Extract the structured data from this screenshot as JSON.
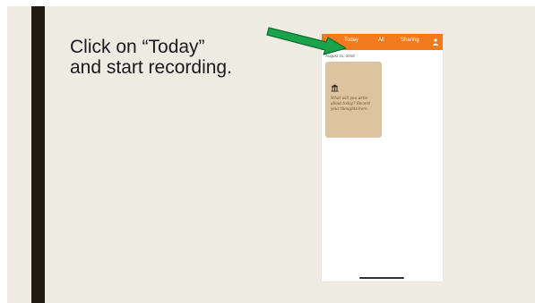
{
  "instruction": {
    "line1": "Click on “Today”",
    "line2": "and start recording."
  },
  "phone": {
    "tabs": {
      "today": "Today",
      "all": "All",
      "sharing": "Sharing"
    },
    "profile_icon": "person-icon",
    "date": "August 31, 2018",
    "card": {
      "icon": "building-icon",
      "prompt": "What will you write about today? Record your thoughts here."
    }
  },
  "colors": {
    "slide_background": "#eeebe3",
    "left_bar": "#1f1a12",
    "app_bar": "#f07a1c",
    "card": "#dcc4a0",
    "arrow": "#1aa34a"
  }
}
